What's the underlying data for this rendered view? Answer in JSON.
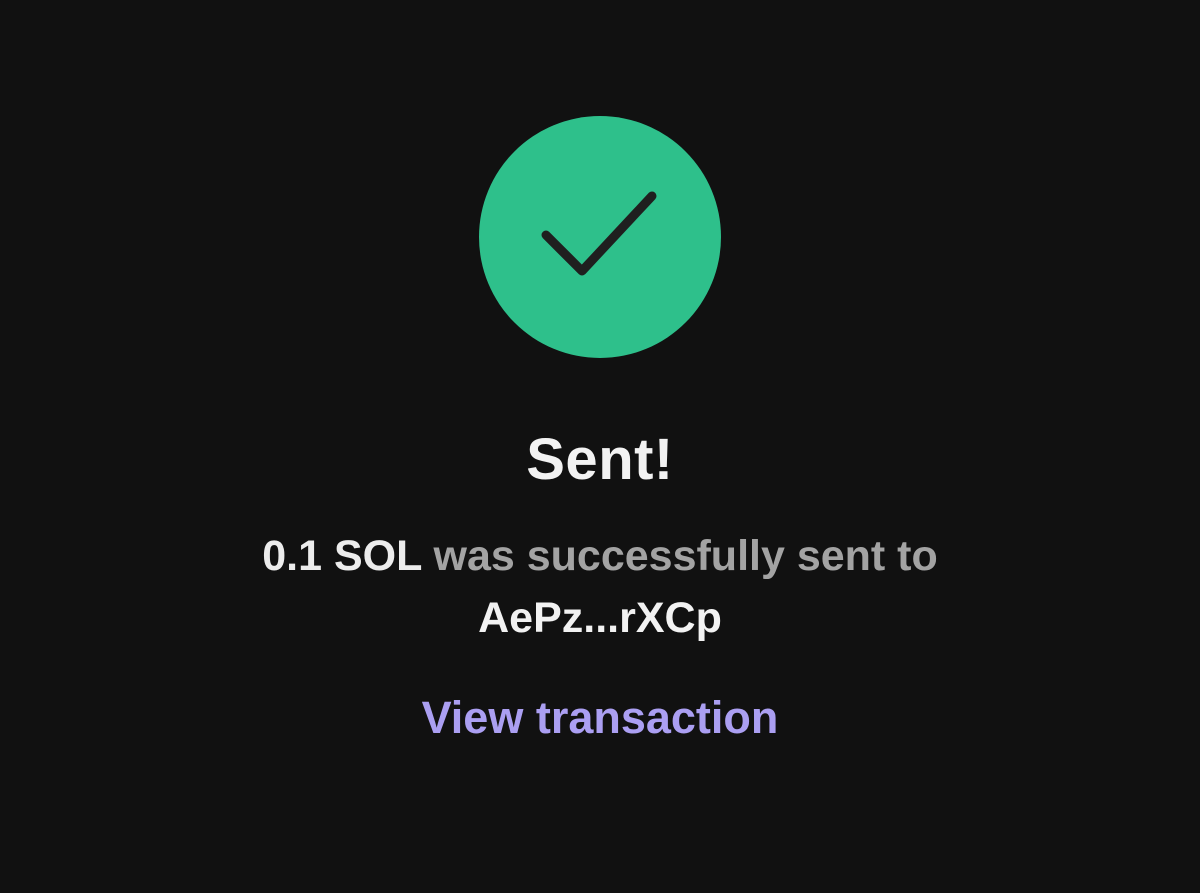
{
  "success": {
    "icon": "checkmark-icon",
    "circle_color": "#2ec08b",
    "check_color": "#1f1f1f"
  },
  "title": "Sent!",
  "message": {
    "amount": "0.1 SOL",
    "text": " was successfully sent to",
    "address": "AePz...rXCp"
  },
  "link": {
    "label": "View transaction",
    "color": "#ab9ff2"
  },
  "background_color": "#111111"
}
